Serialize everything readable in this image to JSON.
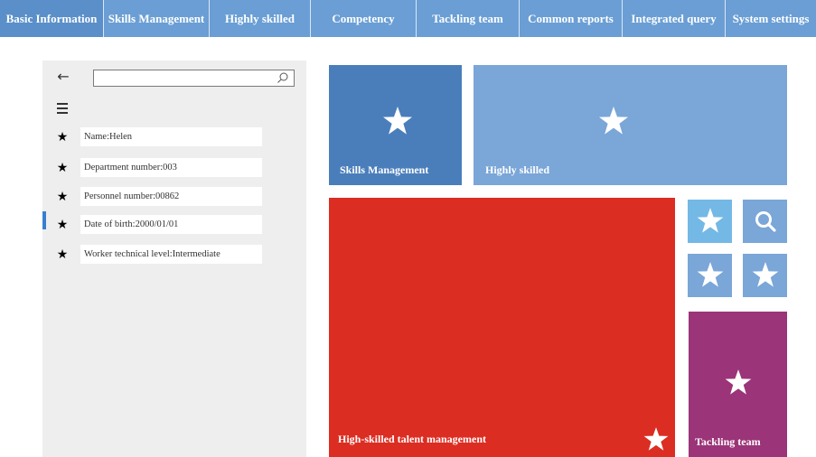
{
  "nav": {
    "items": [
      {
        "label": "Basic Information",
        "active": true
      },
      {
        "label": "Skills Management",
        "active": false
      },
      {
        "label": "Highly skilled",
        "active": false
      },
      {
        "label": "Competency",
        "active": false
      },
      {
        "label": "Tackling team",
        "active": false
      },
      {
        "label": "Common reports",
        "active": false
      },
      {
        "label": "Integrated query",
        "active": false
      },
      {
        "label": "System settings",
        "active": false
      }
    ]
  },
  "panel": {
    "back_icon": "arrow-left-icon",
    "menu_icon": "hamburger-menu-icon",
    "search": {
      "value": "",
      "placeholder": "",
      "icon": "search-icon"
    },
    "fields": [
      {
        "text": "Name:Helen",
        "icon": "star-icon"
      },
      {
        "text": "Department number:003",
        "icon": "star-icon"
      },
      {
        "text": "Personnel number:00862",
        "icon": "star-icon"
      },
      {
        "text": "Date of birth:2000/01/01",
        "icon": "star-icon",
        "selected": true
      },
      {
        "text": "Worker technical level:Intermediate",
        "icon": "star-icon"
      }
    ]
  },
  "tiles": {
    "skills_management": {
      "label": "Skills Management",
      "color": "#4a7ebb",
      "icon": "star-icon"
    },
    "highly_skilled": {
      "label": "Highly skilled",
      "color": "#7aa6d8",
      "icon": "star-icon"
    },
    "high_skilled_talent": {
      "label": "High-skilled talent management",
      "color": "#dc2d22",
      "icon": "star-icon"
    },
    "small_tiles": [
      {
        "icon": "star-icon",
        "color": "#74b8e6"
      },
      {
        "icon": "search-icon",
        "color": "#7aa6d8"
      },
      {
        "icon": "star-icon",
        "color": "#7aa6d8"
      },
      {
        "icon": "star-icon",
        "color": "#7aa6d8"
      }
    ],
    "tackling_team": {
      "label": "Tackling team",
      "color": "#9b3478",
      "icon": "star-icon"
    }
  }
}
